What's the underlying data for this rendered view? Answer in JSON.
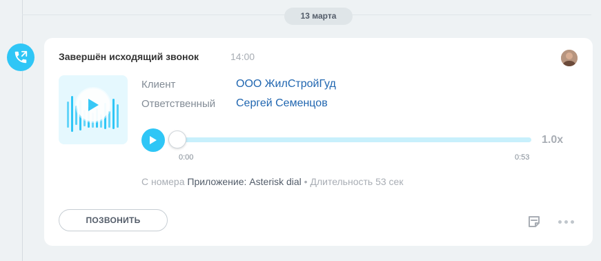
{
  "date_separator": {
    "label": "13 марта"
  },
  "activity": {
    "title": "Завершён исходящий звонок",
    "time": "14:00",
    "icon": "outgoing-call-icon",
    "accent_color": "#2fc6f6"
  },
  "fields": [
    {
      "label": "Клиент",
      "value": "ООО ЖилСтройГуд"
    },
    {
      "label": "Ответственный",
      "value": "Сергей Семенцов"
    }
  ],
  "player": {
    "speed": "1.0x",
    "current_time": "0:00",
    "duration": "0:53",
    "progress": 0
  },
  "meta": {
    "from_label": "С номера",
    "app": "Приложение: Asterisk dial",
    "separator": "•",
    "duration_text": "Длительность 53 сек"
  },
  "actions": {
    "call_button": "ПОЗВОНИТЬ",
    "note_icon": "note-icon",
    "more_icon": "more-icon"
  }
}
